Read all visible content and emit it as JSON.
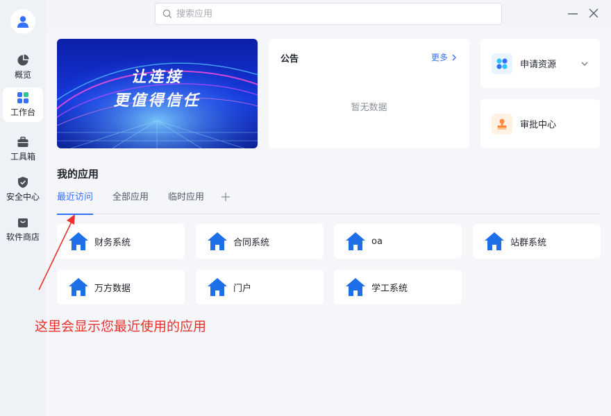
{
  "search": {
    "placeholder": "搜索应用"
  },
  "sidebar": {
    "items": [
      {
        "label": "概览",
        "icon": "pie-chart-icon"
      },
      {
        "label": "工作台",
        "icon": "workbench-icon"
      },
      {
        "label": "工具箱",
        "icon": "toolbox-icon"
      },
      {
        "label": "安全中心",
        "icon": "shield-icon"
      },
      {
        "label": "软件商店",
        "icon": "store-bag-icon"
      }
    ],
    "active_index": 1
  },
  "banner": {
    "line1": "让连接",
    "line2": "更值得信任"
  },
  "notice": {
    "title": "公告",
    "more": "更多",
    "empty": "暂无数据"
  },
  "quick": {
    "apply": {
      "label": "申请资源",
      "icon": "apps-grid-icon"
    },
    "approve": {
      "label": "审批中心",
      "icon": "stamp-icon"
    }
  },
  "my_apps": {
    "title": "我的应用",
    "tabs": [
      "最近访问",
      "全部应用",
      "临时应用"
    ],
    "active_tab": 0,
    "apps": [
      "财务系统",
      "合同系统",
      "oa",
      "站群系统",
      "万方数据",
      "门户",
      "学工系统"
    ]
  },
  "annotation": "这里会显示您最近使用的应用",
  "colors": {
    "accent": "#3370ff",
    "annotation": "#e8312a",
    "app_icon": "#1e6fe8"
  }
}
